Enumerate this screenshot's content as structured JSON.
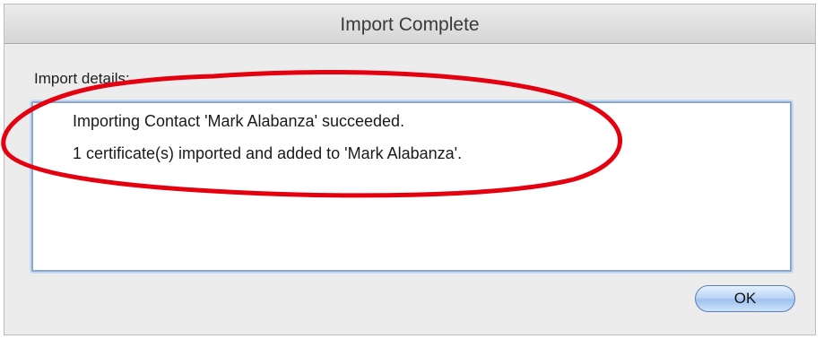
{
  "dialog": {
    "title": "Import Complete",
    "details_label": "Import details:",
    "details_lines": [
      "Importing Contact 'Mark Alabanza' succeeded.",
      "1 certificate(s) imported and added to 'Mark Alabanza'."
    ],
    "ok_label": "OK"
  },
  "annotation": {
    "shape": "ellipse",
    "color": "#e4000f"
  }
}
